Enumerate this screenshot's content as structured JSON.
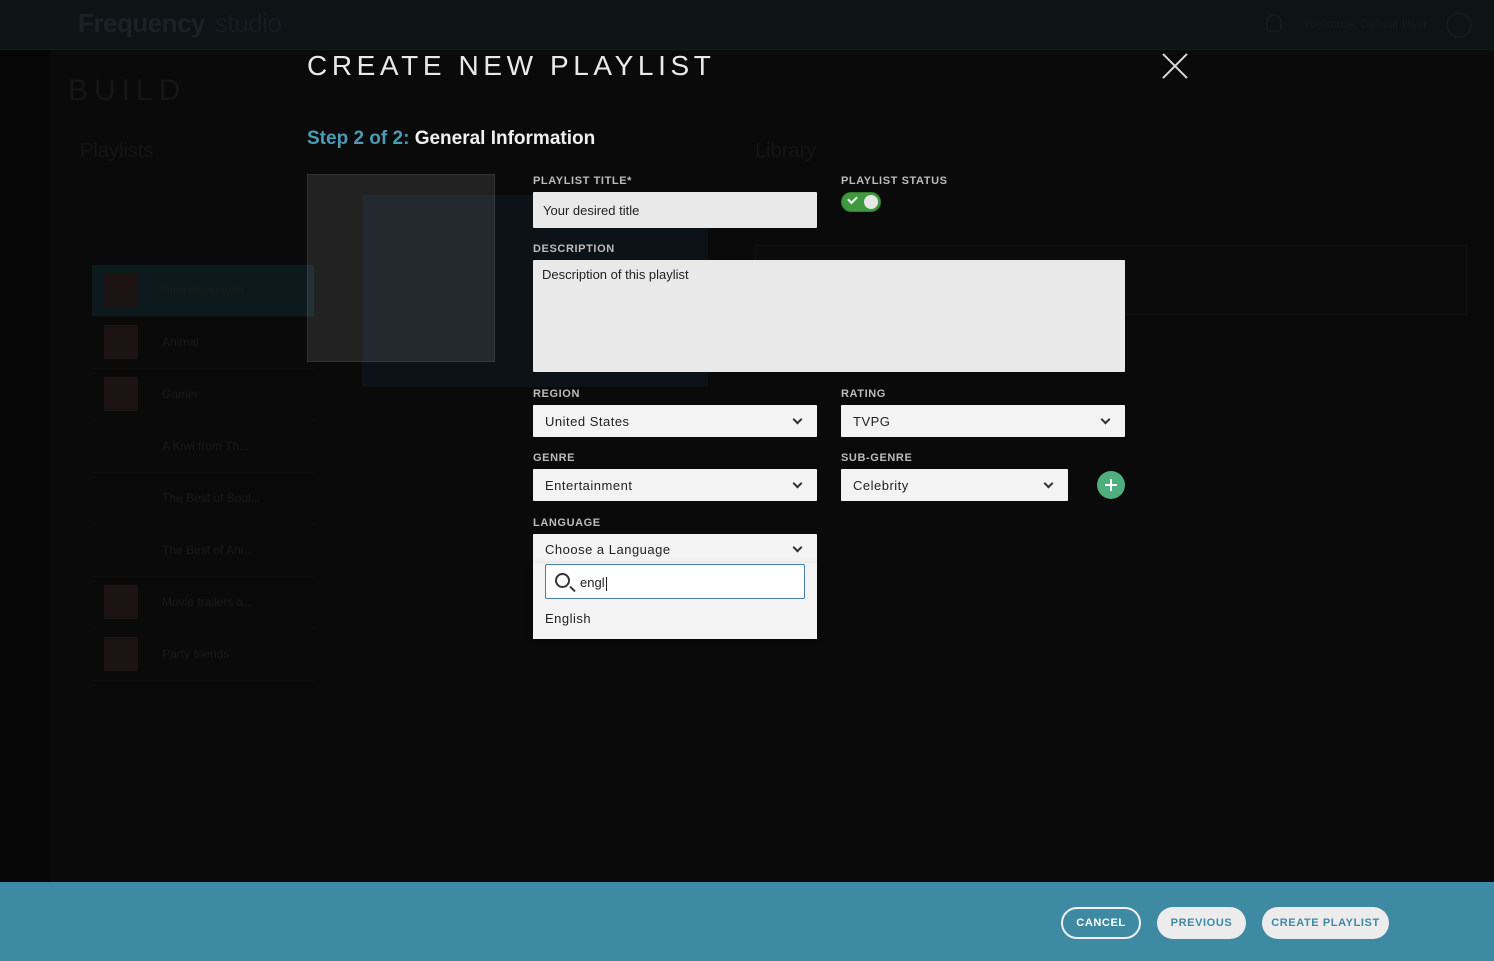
{
  "background": {
    "logo": "Frequency",
    "logo_suffix": "studio",
    "welcome_text": "Welcome, Default User",
    "section_title": "BUILD",
    "playlists_title": "Playlists",
    "library_title": "Library",
    "playlist_rows": [
      {
        "name": "Sing along with ..."
      },
      {
        "name": "Animal"
      },
      {
        "name": "Gamer"
      },
      {
        "name": "A Kiwi from Th..."
      },
      {
        "name": "The Best of Soul..."
      },
      {
        "name": "The Best of Ani..."
      },
      {
        "name": "Movie trailers a..."
      },
      {
        "name": "Party friends"
      }
    ]
  },
  "modal": {
    "title": "CREATE NEW PLAYLIST",
    "step_prefix": "Step 2 of 2:",
    "step_name": "General Information",
    "fields": {
      "playlist_title": {
        "label": "PLAYLIST TITLE*",
        "value": "Your desired title"
      },
      "playlist_status": {
        "label": "PLAYLIST STATUS",
        "enabled": true
      },
      "description": {
        "label": "DESCRIPTION",
        "value": "Description of this playlist"
      },
      "region": {
        "label": "REGION",
        "value": "United States"
      },
      "rating": {
        "label": "RATING",
        "value": "TVPG"
      },
      "genre": {
        "label": "GENRE",
        "value": "Entertainment"
      },
      "sub_genre": {
        "label": "SUB-GENRE",
        "value": "Celebrity"
      },
      "language": {
        "label": "LANGUAGE",
        "value": "Choose a Language",
        "search_query": "engl",
        "options": [
          "English"
        ]
      }
    }
  },
  "footer": {
    "cancel_label": "CANCEL",
    "previous_label": "PREVIOUS",
    "create_label": "CREATE PLAYLIST"
  },
  "colors": {
    "accent": "#3f8aa3",
    "step_prefix": "#4a9bb8",
    "toggle_on": "#3f9a3f",
    "add_button": "#4fae7e"
  },
  "icons": {
    "close": "close-icon",
    "toggle_check": "check-icon",
    "add": "plus-icon",
    "search": "search-icon",
    "chevron": "chevron-down-icon"
  }
}
